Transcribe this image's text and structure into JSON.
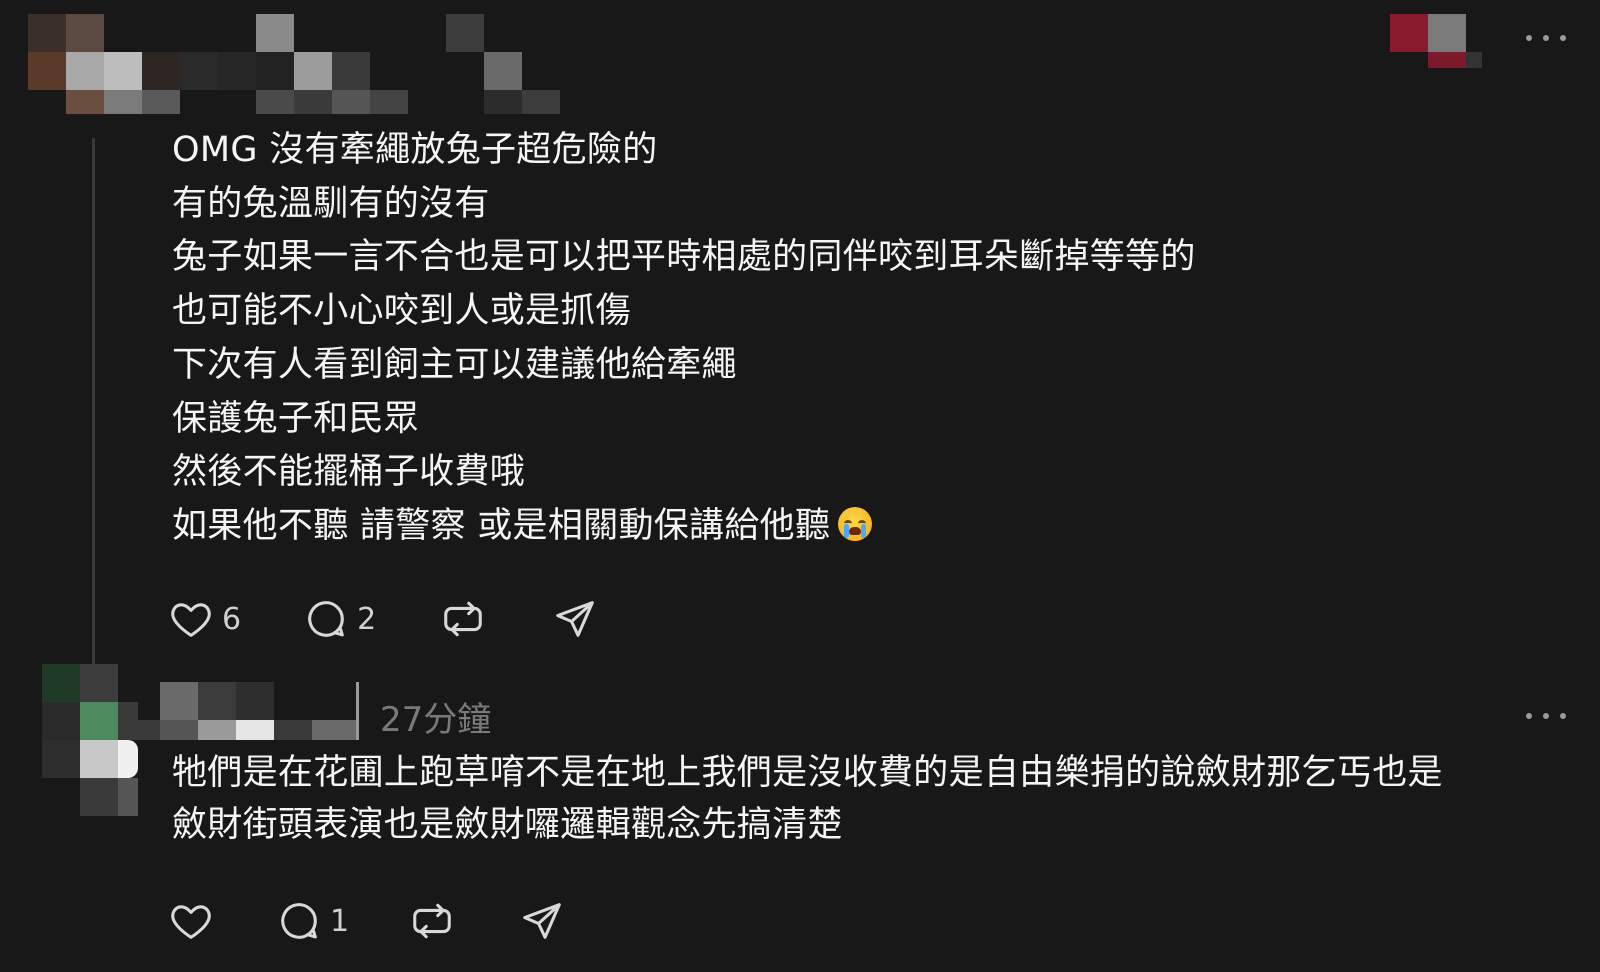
{
  "comments": [
    {
      "text": "OMG 沒有牽繩放兔子超危險的\n有的兔溫馴有的沒有\n兔子如果一言不合也是可以把平時相處的同伴咬到耳朵斷掉等等的\n也可能不小心咬到人或是抓傷\n下次有人看到飼主可以建議他給牽繩\n保護兔子和民眾\n然後不能擺桶子收費哦\n如果他不聽 請警察 或是相關動保講給他聽",
      "emoji": "loudly-crying-face",
      "likes": "6",
      "replies": "2"
    },
    {
      "timestamp": "27分鐘",
      "text": "牠們是在花圃上跑草唷不是在地上我們是沒收費的是自由樂捐的說斂財那乞丐也是\n斂財街頭表演也是斂財囉邏輯觀念先搞清楚",
      "likes": "",
      "replies": "1"
    }
  ],
  "colors": {
    "background": "#181818",
    "text": "#f3f5f7",
    "muted": "#7a7a7a",
    "thread_line": "#3a3a3a"
  },
  "icons": [
    "heart-icon",
    "comment-icon",
    "repost-icon",
    "share-icon",
    "more-icon"
  ]
}
